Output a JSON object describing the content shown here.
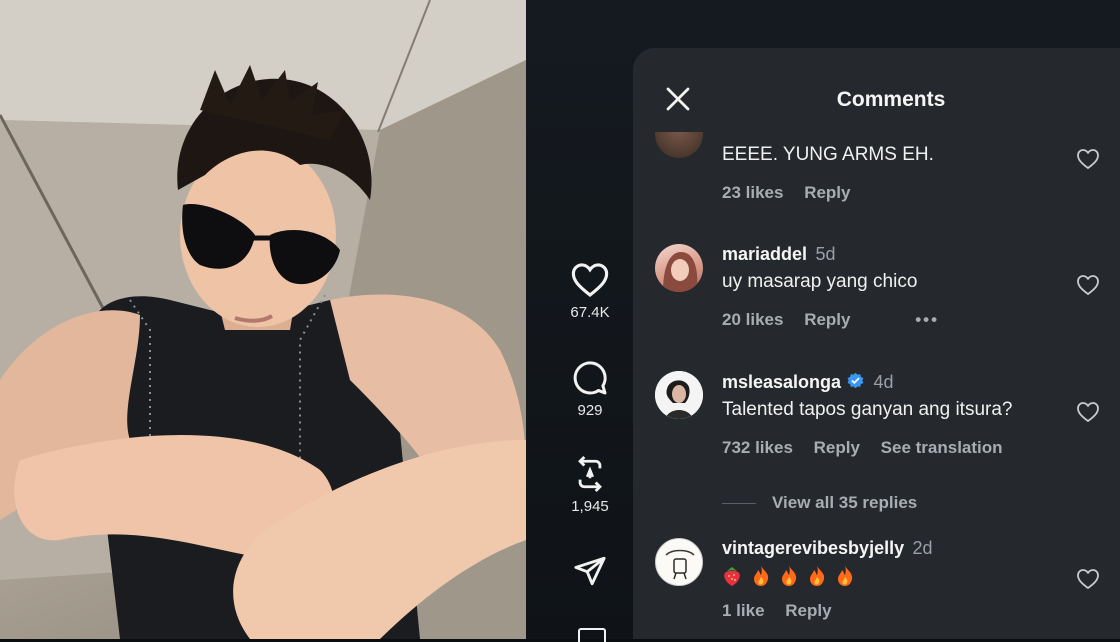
{
  "video": {
    "subject_icon": "person-dancing-video"
  },
  "actions": {
    "like": {
      "icon": "heart-icon",
      "count": "67.4K"
    },
    "comment": {
      "icon": "comment-bubble-icon",
      "count": "929"
    },
    "repost": {
      "icon": "repost-icon",
      "count": "1,945"
    },
    "share": {
      "icon": "send-icon"
    }
  },
  "panel": {
    "title": "Comments",
    "close_icon": "close-icon"
  },
  "comments": [
    {
      "text": "EEEE. YUNG ARMS EH.",
      "likes": "23 likes",
      "reply": "Reply"
    },
    {
      "name": "mariaddel",
      "time": "5d",
      "text": "uy masarap yang chico",
      "likes": "20 likes",
      "reply": "Reply",
      "more": "•••"
    },
    {
      "name": "msleasalonga",
      "time": "4d",
      "text": "Talented tapos ganyan ang itsura?",
      "likes": "732 likes",
      "reply": "Reply",
      "translate": "See translation",
      "verified": true
    },
    {
      "name": "vintagerevibesbyjelly",
      "time": "2d",
      "likes": "1 like",
      "reply": "Reply",
      "emojis": [
        "strawberry",
        "fire",
        "fire",
        "fire",
        "fire"
      ]
    }
  ],
  "view_replies": "View all 35 replies",
  "colors": {
    "panel_bg": "#25282c",
    "verified": "#3897f0",
    "fire": "#ff6a1a"
  }
}
